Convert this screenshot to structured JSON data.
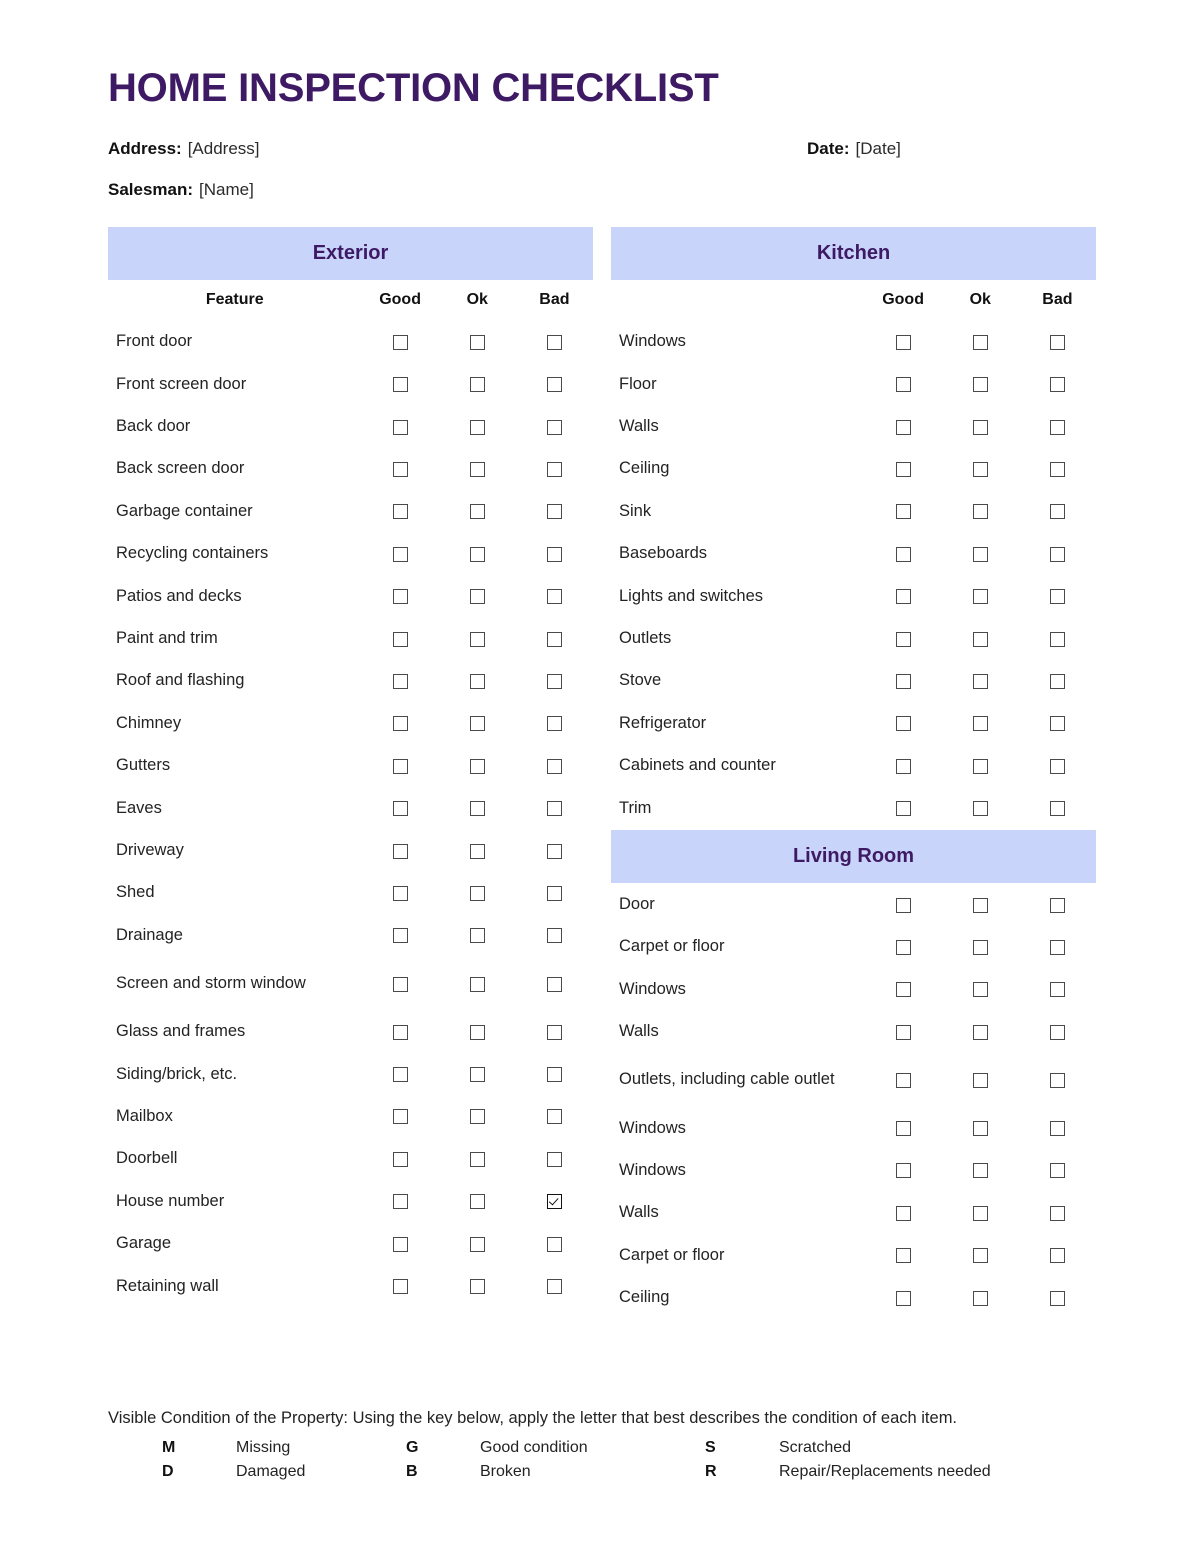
{
  "title": "HOME INSPECTION CHECKLIST",
  "theme": {
    "title_color": "#3d1a63",
    "band_bg": "#c9d4fb",
    "band_text": "#3d1a63"
  },
  "meta": {
    "address_label": "Address:",
    "address_value": "[Address]",
    "salesman_label": "Salesman:",
    "salesman_value": "[Name]",
    "date_label": "Date:",
    "date_value": "[Date]"
  },
  "columns": {
    "headers": {
      "feature": "Feature",
      "good": "Good",
      "ok": "Ok",
      "bad": "Bad"
    },
    "left": {
      "section": "Exterior",
      "show_feature_header": true,
      "rows": [
        {
          "label": "Front door",
          "good": false,
          "ok": false,
          "bad": false
        },
        {
          "label": "Front screen door",
          "good": false,
          "ok": false,
          "bad": false
        },
        {
          "label": "Back door",
          "good": false,
          "ok": false,
          "bad": false
        },
        {
          "label": "Back screen door",
          "good": false,
          "ok": false,
          "bad": false
        },
        {
          "label": "Garbage container",
          "good": false,
          "ok": false,
          "bad": false
        },
        {
          "label": "Recycling containers",
          "good": false,
          "ok": false,
          "bad": false
        },
        {
          "label": "Patios and decks",
          "good": false,
          "ok": false,
          "bad": false
        },
        {
          "label": "Paint and trim",
          "good": false,
          "ok": false,
          "bad": false
        },
        {
          "label": "Roof and flashing",
          "good": false,
          "ok": false,
          "bad": false
        },
        {
          "label": "Chimney",
          "good": false,
          "ok": false,
          "bad": false
        },
        {
          "label": "Gutters",
          "good": false,
          "ok": false,
          "bad": false
        },
        {
          "label": "Eaves",
          "good": false,
          "ok": false,
          "bad": false
        },
        {
          "label": "Driveway",
          "good": false,
          "ok": false,
          "bad": false
        },
        {
          "label": "Shed",
          "good": false,
          "ok": false,
          "bad": false
        },
        {
          "label": "Drainage",
          "good": false,
          "ok": false,
          "bad": false
        },
        {
          "label": "Screen and storm window",
          "good": false,
          "ok": false,
          "bad": false,
          "two_line": true
        },
        {
          "label": "Glass and frames",
          "good": false,
          "ok": false,
          "bad": false
        },
        {
          "label": "Siding/brick, etc.",
          "good": false,
          "ok": false,
          "bad": false
        },
        {
          "label": "Mailbox",
          "good": false,
          "ok": false,
          "bad": false
        },
        {
          "label": "Doorbell",
          "good": false,
          "ok": false,
          "bad": false
        },
        {
          "label": "House number",
          "good": false,
          "ok": false,
          "bad": true
        },
        {
          "label": "Garage",
          "good": false,
          "ok": false,
          "bad": false
        },
        {
          "label": "Retaining wall",
          "good": false,
          "ok": false,
          "bad": false
        }
      ]
    },
    "right_top": {
      "section": "Kitchen",
      "show_feature_header": false,
      "rows": [
        {
          "label": "Windows",
          "good": false,
          "ok": false,
          "bad": false
        },
        {
          "label": "Floor",
          "good": false,
          "ok": false,
          "bad": false
        },
        {
          "label": "Walls",
          "good": false,
          "ok": false,
          "bad": false
        },
        {
          "label": "Ceiling",
          "good": false,
          "ok": false,
          "bad": false
        },
        {
          "label": "Sink",
          "good": false,
          "ok": false,
          "bad": false
        },
        {
          "label": "Baseboards",
          "good": false,
          "ok": false,
          "bad": false
        },
        {
          "label": "Lights and switches",
          "good": false,
          "ok": false,
          "bad": false
        },
        {
          "label": "Outlets",
          "good": false,
          "ok": false,
          "bad": false
        },
        {
          "label": "Stove",
          "good": false,
          "ok": false,
          "bad": false
        },
        {
          "label": "Refrigerator",
          "good": false,
          "ok": false,
          "bad": false
        },
        {
          "label": "Cabinets and counter",
          "good": false,
          "ok": false,
          "bad": false
        },
        {
          "label": "Trim",
          "good": false,
          "ok": false,
          "bad": false
        }
      ]
    },
    "right_bottom": {
      "section": "Living Room",
      "show_feature_header": false,
      "rows": [
        {
          "label": "Door",
          "good": false,
          "ok": false,
          "bad": false
        },
        {
          "label": "Carpet or floor",
          "good": false,
          "ok": false,
          "bad": false
        },
        {
          "label": "Windows",
          "good": false,
          "ok": false,
          "bad": false
        },
        {
          "label": "Walls",
          "good": false,
          "ok": false,
          "bad": false
        },
        {
          "label": "Outlets, including cable outlet",
          "good": false,
          "ok": false,
          "bad": false,
          "two_line": true
        },
        {
          "label": "Windows",
          "good": false,
          "ok": false,
          "bad": false
        },
        {
          "label": "Windows",
          "good": false,
          "ok": false,
          "bad": false
        },
        {
          "label": "Walls",
          "good": false,
          "ok": false,
          "bad": false
        },
        {
          "label": "Carpet or floor",
          "good": false,
          "ok": false,
          "bad": false
        },
        {
          "label": "Ceiling",
          "good": false,
          "ok": false,
          "bad": false
        }
      ]
    }
  },
  "footer": {
    "note": "Visible Condition of the Property: Using the key below, apply the letter that best describes the condition of each item.",
    "legend": [
      [
        {
          "key": "M",
          "value": "Missing"
        },
        {
          "key": "G",
          "value": "Good condition"
        },
        {
          "key": "S",
          "value": "Scratched"
        }
      ],
      [
        {
          "key": "D",
          "value": "Damaged"
        },
        {
          "key": "B",
          "value": "Broken"
        },
        {
          "key": "R",
          "value": "Repair/Replacements needed"
        }
      ]
    ]
  }
}
